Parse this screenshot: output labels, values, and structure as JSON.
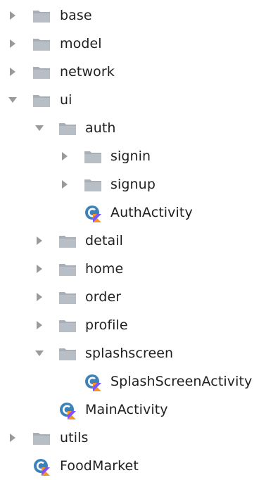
{
  "colors": {
    "arrow": "#9a9a9a",
    "folder": "#a7aeb7",
    "kotlin_class_c": "#3b82b9",
    "kotlin_orange": "#f39425",
    "kotlin_purple": "#7f52ff",
    "text": "#1f1f1f"
  },
  "tree": {
    "base": {
      "label": "base",
      "icon": "folder-icon",
      "expanded": false
    },
    "model": {
      "label": "model",
      "icon": "folder-icon",
      "expanded": false
    },
    "network": {
      "label": "network",
      "icon": "folder-icon",
      "expanded": false
    },
    "ui": {
      "label": "ui",
      "icon": "folder-icon",
      "expanded": true
    },
    "auth": {
      "label": "auth",
      "icon": "folder-icon",
      "expanded": true
    },
    "signin": {
      "label": "signin",
      "icon": "folder-icon",
      "expanded": false
    },
    "signup": {
      "label": "signup",
      "icon": "folder-icon",
      "expanded": false
    },
    "auth_activity": {
      "label": "AuthActivity",
      "icon": "kotlin-class-icon"
    },
    "detail": {
      "label": "detail",
      "icon": "folder-icon",
      "expanded": false
    },
    "home": {
      "label": "home",
      "icon": "folder-icon",
      "expanded": false
    },
    "order": {
      "label": "order",
      "icon": "folder-icon",
      "expanded": false
    },
    "profile": {
      "label": "profile",
      "icon": "folder-icon",
      "expanded": false
    },
    "splashscreen": {
      "label": "splashscreen",
      "icon": "folder-icon",
      "expanded": true
    },
    "splash_activity": {
      "label": "SplashScreenActivity",
      "icon": "kotlin-class-icon"
    },
    "main_activity": {
      "label": "MainActivity",
      "icon": "kotlin-class-icon"
    },
    "utils": {
      "label": "utils",
      "icon": "folder-icon",
      "expanded": false
    },
    "food_market": {
      "label": "FoodMarket",
      "icon": "kotlin-class-icon"
    }
  }
}
